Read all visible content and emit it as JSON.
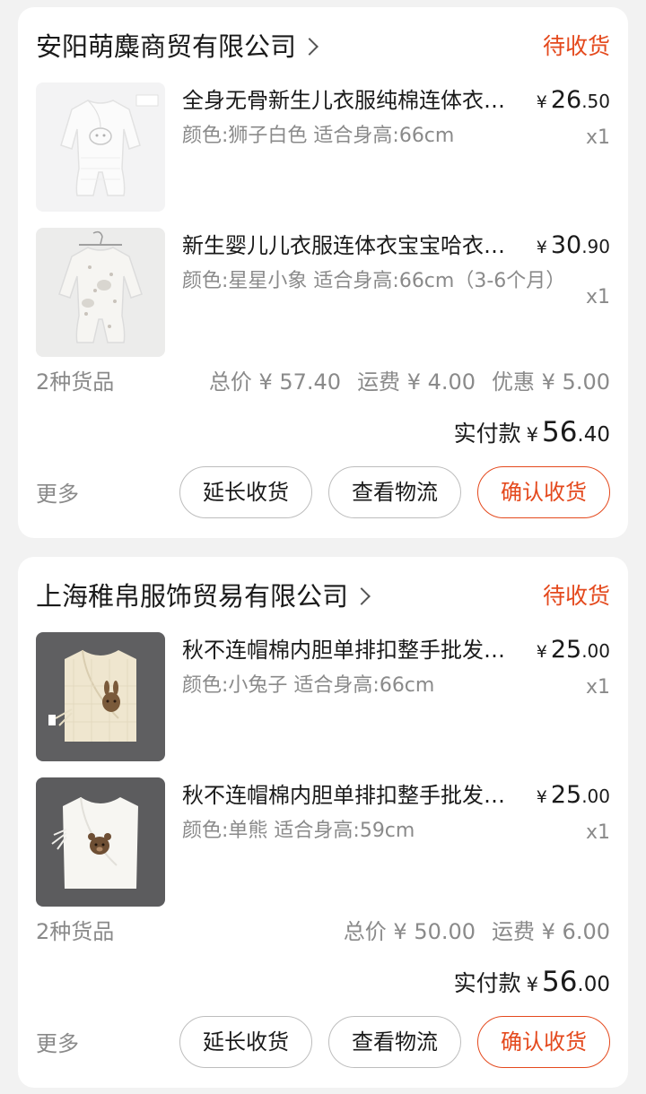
{
  "colors": {
    "accent": "#e4491d",
    "background": "#f2f2f2",
    "card": "#ffffff",
    "text_primary": "#1a1a1a",
    "text_secondary": "#8a8a8a"
  },
  "orders": [
    {
      "shop_name": "安阳萌麋商贸有限公司",
      "status": "待收货",
      "items": [
        {
          "image": "white-quilted-romper-photo",
          "title": "全身无骨新生儿衣服纯棉连体衣宝宝哈衣",
          "spec": "颜色:狮子白色 适合身高:66cm",
          "price_symbol": "¥",
          "price_int": "26",
          "price_dec": ".50",
          "quantity": "x1"
        },
        {
          "image": "printed-romper-photo",
          "title": "新生婴儿儿衣服连体衣宝宝哈衣爬服",
          "spec": "颜色:星星小象 适合身高:66cm（3-6个月）",
          "price_symbol": "¥",
          "price_int": "30",
          "price_dec": ".90",
          "quantity": "x1"
        }
      ],
      "item_count": "2种货品",
      "total": "总价 ¥ 57.40",
      "shipping": "运费 ¥ 4.00",
      "discount": "优惠 ¥ 5.00",
      "paid_label": "实付款",
      "paid_symbol": "¥",
      "paid_int": "56",
      "paid_dec": ".40",
      "more_label": "更多",
      "buttons": {
        "extend": "延长收货",
        "logistics": "查看物流",
        "confirm": "确认收货"
      }
    },
    {
      "shop_name": "上海稚帛服饰贸易有限公司",
      "status": "待收货",
      "items": [
        {
          "image": "cream-vest-bunny-photo",
          "title": "秋不连帽棉内胆单排扣整手批发马甲",
          "spec": "颜色:小兔子 适合身高:66cm",
          "price_symbol": "¥",
          "price_int": "25",
          "price_dec": ".00",
          "quantity": "x1"
        },
        {
          "image": "white-vest-bear-photo",
          "title": "秋不连帽棉内胆单排扣整手批发马甲",
          "spec": "颜色:单熊 适合身高:59cm",
          "price_symbol": "¥",
          "price_int": "25",
          "price_dec": ".00",
          "quantity": "x1"
        }
      ],
      "item_count": "2种货品",
      "total": "总价 ¥ 50.00",
      "shipping": "运费 ¥ 6.00",
      "discount": "",
      "paid_label": "实付款",
      "paid_symbol": "¥",
      "paid_int": "56",
      "paid_dec": ".00",
      "more_label": "更多",
      "buttons": {
        "extend": "延长收货",
        "logistics": "查看物流",
        "confirm": "确认收货"
      }
    }
  ]
}
